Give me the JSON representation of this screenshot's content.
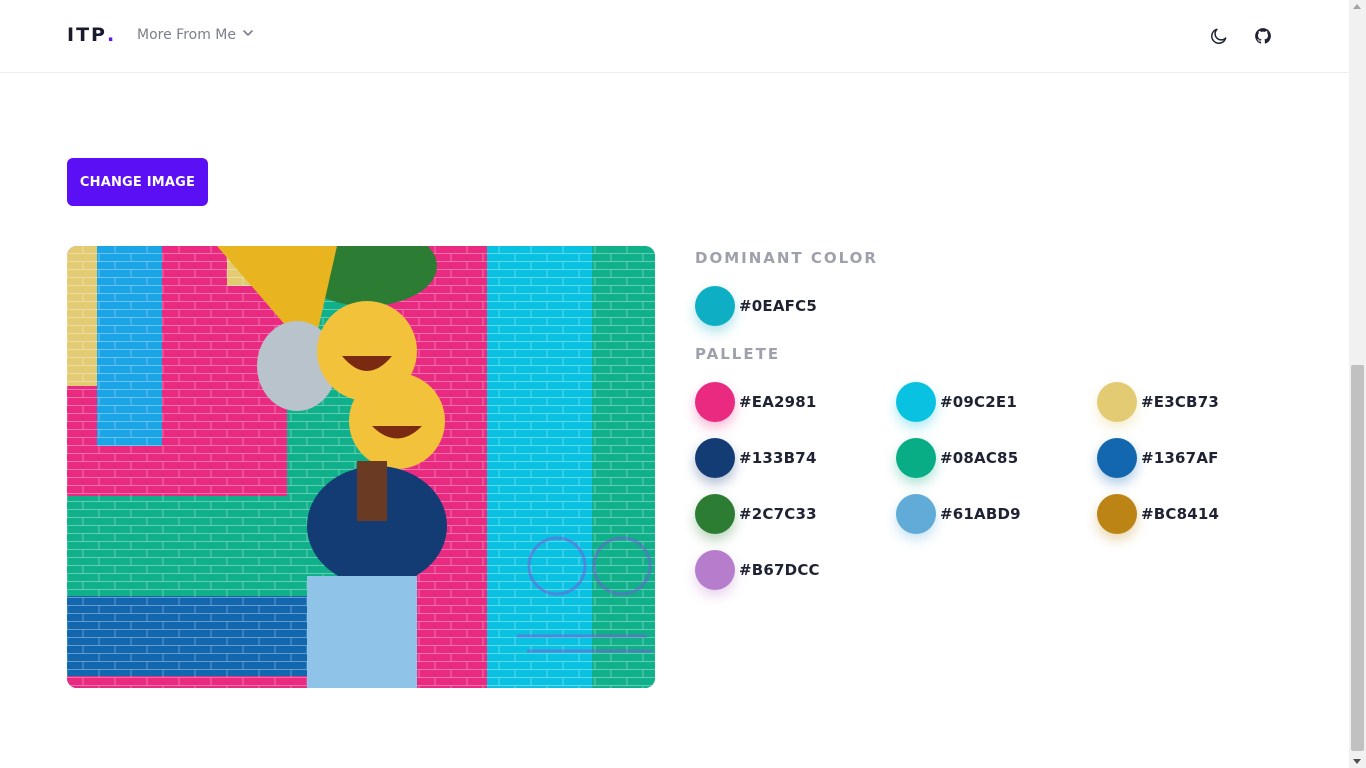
{
  "nav": {
    "logo_text": "ITP",
    "logo_dot": ".",
    "more_label": "More From Me",
    "icons": [
      "moon-icon",
      "github-icon",
      "chevron-down-icon"
    ]
  },
  "actions": {
    "change_image_label": "CHANGE IMAGE"
  },
  "image": {
    "description_icon": "photo",
    "accent": "#5b0ff5"
  },
  "dominant": {
    "title": "DOMINANT COLOR",
    "color": "#0EAFC5",
    "label": "#0EAFC5"
  },
  "palette": {
    "title": "PALLETE",
    "colors": [
      {
        "hex": "#EA2981"
      },
      {
        "hex": "#09C2E1"
      },
      {
        "hex": "#E3CB73"
      },
      {
        "hex": "#133B74"
      },
      {
        "hex": "#08AC85"
      },
      {
        "hex": "#1367AF"
      },
      {
        "hex": "#2C7C33"
      },
      {
        "hex": "#61ABD9"
      },
      {
        "hex": "#BC8414"
      },
      {
        "hex": "#B67DCC"
      }
    ]
  }
}
